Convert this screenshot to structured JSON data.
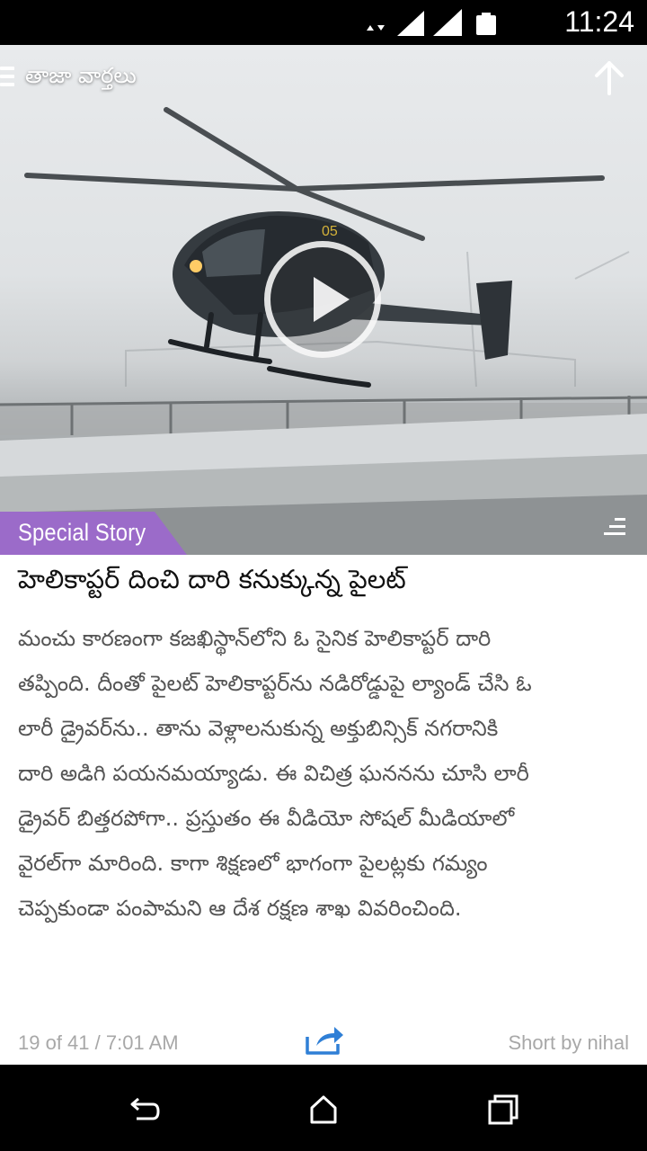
{
  "status_bar": {
    "time": "11:24",
    "icons": [
      "data-arrows-icon",
      "wifi-signal-icon",
      "cell-signal-icon",
      "battery-icon"
    ]
  },
  "header": {
    "section_title": "తాజా వార్తలు",
    "menu_icon": "menu-icon",
    "scroll_top_icon": "up-arrow-icon"
  },
  "media": {
    "type": "video",
    "play_icon": "play-icon",
    "badge_label": "Special Story",
    "badge_color": "#9b6bc9",
    "list_icon": "list-icon"
  },
  "article": {
    "headline": "హెలికాప్టర్ దించి దారి కనుక్కున్న పైలట్",
    "body_lines": [
      "మంచు కారణంగా కజఖిస్థాన్‌లోని ఓ సైనిక హెలికాప్టర్ దారి",
      "తప్పింది. దీంతో పైలట్ హెలికాప్టర్‌ను నడిరోడ్డుపై ల్యాండ్ చేసి ఓ",
      "లారీ డ్రైవర్‌ను.. తాను వెళ్లాలనుకున్న అక్తుబిన్సిక్ నగరానికి",
      "దారి అడిగి పయనమయ్యాడు. ఈ విచిత్ర ఘననను చూసి లారీ",
      "డ్రైవర్ బిత్తరపోగా.. ప్రస్తుతం ఈ వీడియో సోషల్ మీడియాలో",
      "వైరల్‌గా మారింది. కాగా శిక్షణలో భాగంగా పైలట్లకు గమ్యం",
      "చెప్పకుండా పంపామని ఆ దేశ రక్షణ శాఖ వివరించింది."
    ]
  },
  "footer": {
    "counter": "19  of  41 / 7:01 AM",
    "share_icon": "share-icon",
    "share_color": "#2f7fd6",
    "author": "Short by nihal"
  },
  "nav_bar": {
    "back_icon": "back-icon",
    "home_icon": "home-icon",
    "recents_icon": "recents-icon"
  }
}
